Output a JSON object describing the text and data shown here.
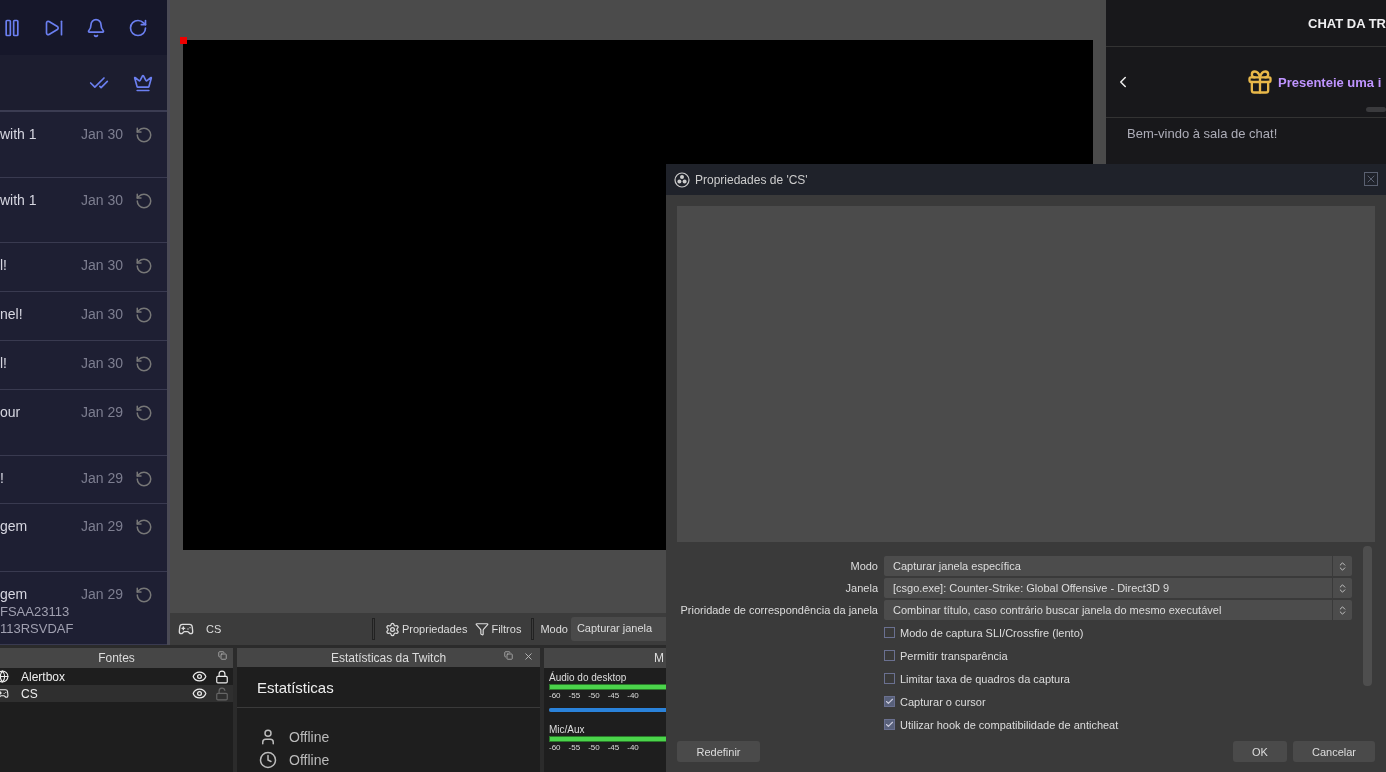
{
  "activity_feed": {
    "items": [
      {
        "text": "with 1",
        "date": "Jan 30"
      },
      {
        "text": "with 1",
        "date": "Jan 30"
      },
      {
        "text": "l!",
        "date": "Jan 30"
      },
      {
        "text": "nel!",
        "date": "Jan 30"
      },
      {
        "text": "l!",
        "date": "Jan 30"
      },
      {
        "text": "our",
        "date": "Jan 29"
      },
      {
        "text": "!",
        "date": "Jan 29"
      },
      {
        "text": "gem",
        "date": "Jan 29"
      },
      {
        "text": "gem",
        "date": "Jan 29",
        "detail_lines": [
          "FSAA23113",
          "113RSVDAF"
        ]
      }
    ]
  },
  "source_toolbar": {
    "source_name": "CS",
    "buttons": [
      {
        "kind": "properties",
        "label": "Propriedades"
      },
      {
        "kind": "filters",
        "label": "Filtros"
      }
    ],
    "mode_label": "Modo",
    "mode_value": "Capturar janela"
  },
  "chat": {
    "title": "CHAT DA TR",
    "gift_banner": "Presenteie uma i",
    "welcome": "Bem-vindo à sala de chat!"
  },
  "docks": {
    "sources": {
      "title": "Fontes",
      "items": [
        {
          "name": "Alertbox",
          "kind": "browser",
          "visible": true,
          "locked": true,
          "selected": false
        },
        {
          "name": "CS",
          "kind": "game",
          "visible": true,
          "locked": false,
          "selected": true
        }
      ]
    },
    "twitch_stats": {
      "title": "Estatísticas da Twitch",
      "heading": "Estatísticas",
      "rows": [
        {
          "kind": "viewers",
          "value": "Offline"
        },
        {
          "kind": "uptime",
          "value": "Offline"
        }
      ]
    },
    "mixer": {
      "title": "M",
      "channels": [
        {
          "name": "Áudio do desktop",
          "scale": [
            "-60",
            "-55",
            "-50",
            "-45",
            "-40"
          ],
          "level": 0.9
        },
        {
          "name": "Mic/Aux",
          "scale": [
            "-60",
            "-55",
            "-50",
            "-45",
            "-40"
          ]
        }
      ]
    }
  },
  "dialog": {
    "title": "Propriedades de 'CS'",
    "fields": [
      {
        "label": "Modo",
        "value": "Capturar janela específica"
      },
      {
        "label": "Janela",
        "value": "[csgo.exe]: Counter-Strike: Global Offensive - Direct3D 9"
      },
      {
        "label": "Prioridade de correspondência da janela",
        "value": "Combinar título, caso contrário buscar janela do mesmo executável"
      }
    ],
    "options": [
      {
        "label": "Modo de captura SLI/Crossfire (lento)",
        "checked": false
      },
      {
        "label": "Permitir transparência",
        "checked": false
      },
      {
        "label": "Limitar taxa de quadros da captura",
        "checked": false
      },
      {
        "label": "Capturar o cursor",
        "checked": true
      },
      {
        "label": "Utilizar hook de compatibilidade de anticheat",
        "checked": true
      }
    ],
    "buttons_left": [
      "Redefinir"
    ],
    "buttons_right": [
      "OK",
      "Cancelar"
    ]
  }
}
